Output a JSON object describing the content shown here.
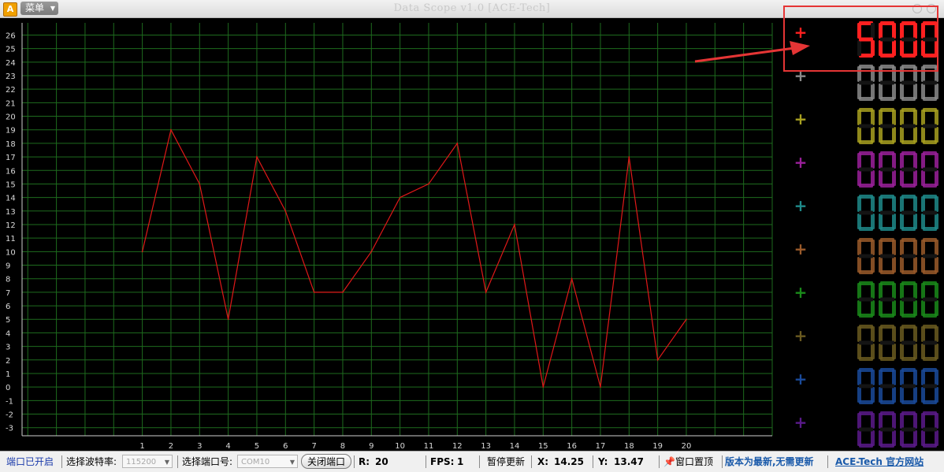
{
  "window": {
    "app_icon_letter": "A",
    "menu_label": "菜单",
    "title": "Data Scope  v1.0    [ACE-Tech]"
  },
  "chart_data": {
    "type": "line",
    "x": [
      1,
      2,
      3,
      4,
      5,
      6,
      7,
      8,
      9,
      10,
      11,
      12,
      13,
      14,
      15,
      16,
      17,
      18,
      19,
      20
    ],
    "series": [
      {
        "color": "#e01818",
        "values": [
          10,
          19,
          15,
          5,
          17,
          13,
          7,
          7,
          10,
          14,
          15,
          18,
          7,
          12,
          0,
          8,
          0,
          17,
          2,
          5
        ]
      }
    ],
    "x_ticks": [
      "1",
      "2",
      "3",
      "4",
      "5",
      "6",
      "7",
      "8",
      "9",
      "10",
      "11",
      "12",
      "13",
      "14",
      "15",
      "16",
      "17",
      "18",
      "19",
      "20"
    ],
    "y_ticks": [
      "26",
      "25",
      "24",
      "23",
      "22",
      "21",
      "20",
      "19",
      "18",
      "17",
      "16",
      "15",
      "14",
      "13",
      "12",
      "11",
      "10",
      "9",
      "8",
      "7",
      "6",
      "5",
      "4",
      "3",
      "2",
      "1",
      "0",
      "-1",
      "-2",
      "-3"
    ],
    "ylim": [
      -3.6,
      26.9
    ],
    "xlim": [
      -3.2,
      23.0
    ],
    "grid": true
  },
  "channels": [
    {
      "label": "+",
      "color": "#ff2020",
      "digits": "5000",
      "active": true
    },
    {
      "label": "+",
      "color": "#8a8a8a",
      "digits": "0000",
      "active": false
    },
    {
      "label": "+",
      "color": "#a8a020",
      "digits": "0000",
      "active": false
    },
    {
      "label": "+",
      "color": "#9a209a",
      "digits": "0000",
      "active": false
    },
    {
      "label": "+",
      "color": "#1f8a8a",
      "digits": "0000",
      "active": false
    },
    {
      "label": "+",
      "color": "#9a5a2a",
      "digits": "0000",
      "active": false
    },
    {
      "label": "+",
      "color": "#1a8a1a",
      "digits": "0000",
      "active": false
    },
    {
      "label": "+",
      "color": "#6a5a20",
      "digits": "0000",
      "active": false
    },
    {
      "label": "+",
      "color": "#1a4a9a",
      "digits": "0000",
      "active": false
    },
    {
      "label": "+",
      "color": "#5a1a8a",
      "digits": "0000",
      "active": false
    }
  ],
  "status": {
    "port_state": "端口已开启",
    "baud_label": "选择波特率:",
    "baud_value": "115200",
    "port_label": "选择端口号:",
    "port_value": "COM10",
    "close_port": "关闭端口",
    "r_label": "R:",
    "r_value": "20",
    "fps_label": "FPS:",
    "fps_value": "1",
    "pause_update": "暂停更新",
    "x_label": "X:",
    "x_value": "14.25",
    "y_label": "Y:",
    "y_value": "13.47",
    "pin_top": "窗口置顶",
    "version_msg": "版本为最新,无需更新",
    "website_prefix": "ACE-Tech",
    "website_suffix": "官方网站"
  },
  "colors": {
    "grid": "#1e6b1e",
    "trace": "#e01818",
    "axis": "#cfcfcf",
    "version_text": "#1a5aaa",
    "link": "#1a5aaa",
    "annotation": "#e53535"
  }
}
